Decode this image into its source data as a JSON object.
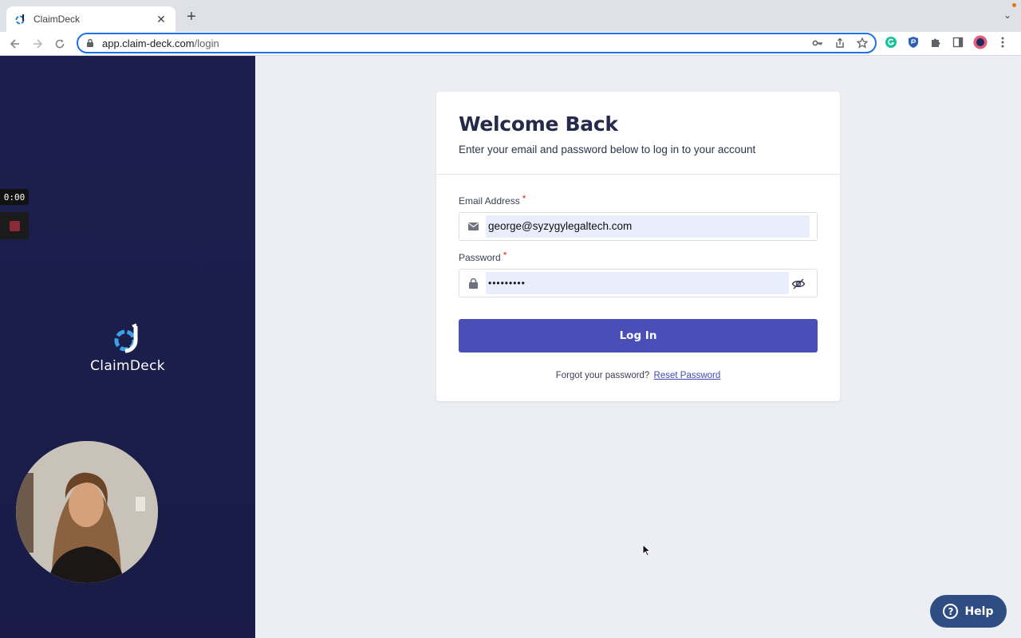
{
  "browser": {
    "tab_title": "ClaimDeck",
    "tab_close": "✕",
    "new_tab": "+",
    "tab_menu": "⌄",
    "url_host": "app.claim-deck.com",
    "url_path": "/login"
  },
  "sidebar": {
    "timer": "0:00",
    "brand_name": "ClaimDeck"
  },
  "login": {
    "title": "Welcome Back",
    "subtitle": "Enter your email and password below to log in to your account",
    "email_label": "Email Address",
    "email_value": "george@syzygylegaltech.com",
    "password_label": "Password",
    "password_value": "•••••••••",
    "required_mark": "*",
    "submit_label": "Log In",
    "forgot_text": "Forgot your password?",
    "reset_link": "Reset Password"
  },
  "help": {
    "label": "Help",
    "icon_glyph": "?"
  },
  "colors": {
    "sidebar_bg": "#1c1f4e",
    "primary_button": "#4a4eb7",
    "help_button": "#2e4d83",
    "required": "#e02424"
  }
}
